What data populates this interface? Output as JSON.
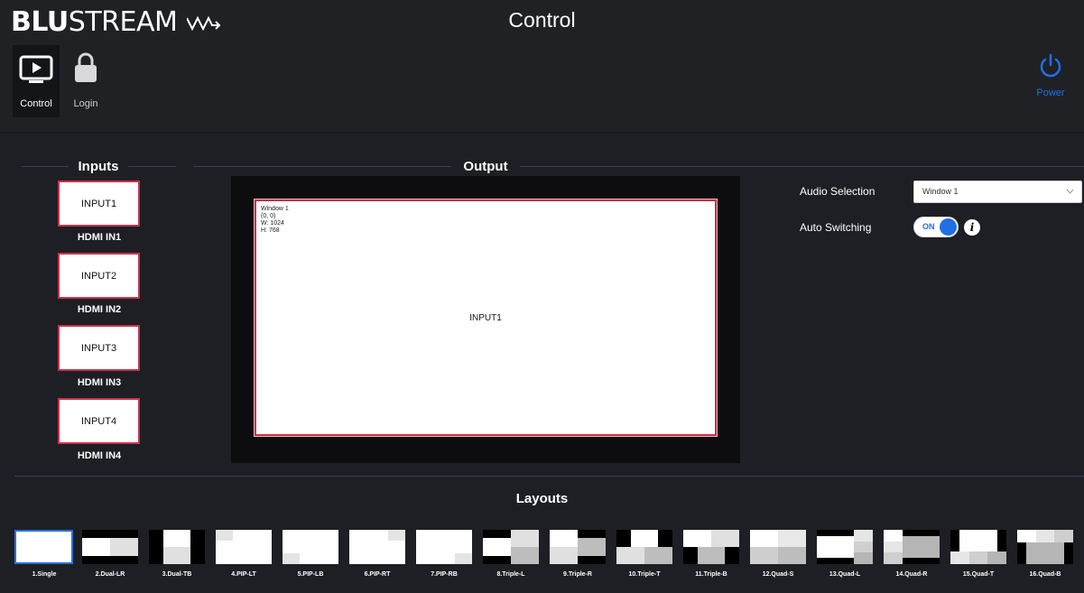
{
  "header": {
    "brand_bold": "BLU",
    "brand_thin": "STREAM",
    "title": "Control"
  },
  "nav": {
    "control_label": "Control",
    "login_label": "Login"
  },
  "power": {
    "label": "Power",
    "color": "#1f6fe5"
  },
  "inputs": {
    "heading": "Inputs",
    "items": [
      {
        "card": "INPUT1",
        "name": "HDMI IN1"
      },
      {
        "card": "INPUT2",
        "name": "HDMI IN2"
      },
      {
        "card": "INPUT3",
        "name": "HDMI IN3"
      },
      {
        "card": "INPUT4",
        "name": "HDMI IN4"
      }
    ]
  },
  "output": {
    "heading": "Output",
    "window": {
      "name": "Window 1",
      "position": "(0, 0)",
      "width": "W: 1024",
      "height": "H: 768",
      "source": "INPUT1"
    }
  },
  "controls": {
    "audio_label": "Audio Selection",
    "audio_value": "Window 1",
    "auto_label": "Auto Switching",
    "auto_state": "ON",
    "info_icon": "i"
  },
  "layouts": {
    "heading": "Layouts",
    "selected": "1.Single",
    "items": [
      "1.Single",
      "2.Dual-LR",
      "3.Dual-TB",
      "4.PIP-LT",
      "5.PIP-LB",
      "6.PIP-RT",
      "7.PIP-RB",
      "8.Triple-L",
      "9.Triple-R",
      "10.Triple-T",
      "11.Triple-B",
      "12.Quad-S",
      "13.Quad-L",
      "14.Quad-R",
      "15.Quad-T",
      "16.Quad-B"
    ]
  },
  "colors": {
    "accent": "#1f6fe5",
    "input_border": "#c8324a",
    "background": "#1e1f24"
  }
}
